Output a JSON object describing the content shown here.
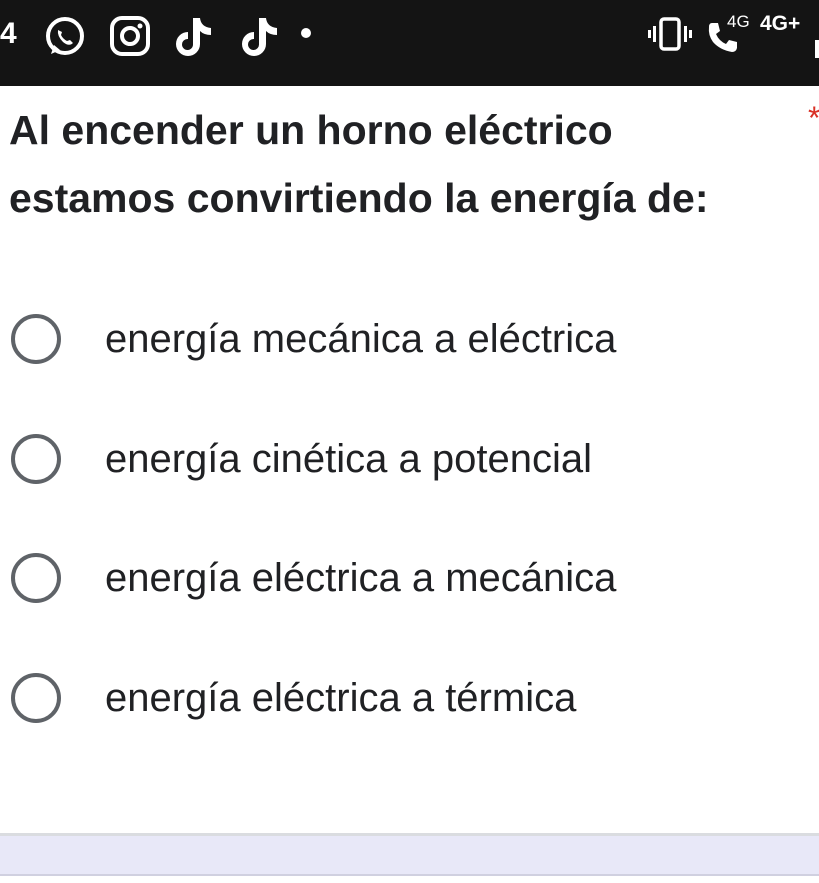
{
  "status_bar": {
    "time_partial": "4",
    "network_small": "4G",
    "network": "4G+",
    "icons": [
      "whatsapp-icon",
      "instagram-icon",
      "tiktok-icon",
      "tiktok-icon",
      "notification-dot",
      "vibrate-icon",
      "call-icon",
      "battery-icon"
    ]
  },
  "question": {
    "text": "Al encender un horno eléctrico estamos convirtiendo la energía de:",
    "required_mark": "*"
  },
  "options": [
    {
      "label": "energía mecánica a eléctrica",
      "selected": false
    },
    {
      "label": "energía cinética a potencial",
      "selected": false
    },
    {
      "label": "energía eléctrica a mecánica",
      "selected": false
    },
    {
      "label": "energía eléctrica a térmica",
      "selected": false
    }
  ],
  "colors": {
    "status_bar_bg": "#141414",
    "required_star": "#d93025",
    "radio_border": "#5f6368",
    "bottom_bar": "#e8e8f8"
  }
}
